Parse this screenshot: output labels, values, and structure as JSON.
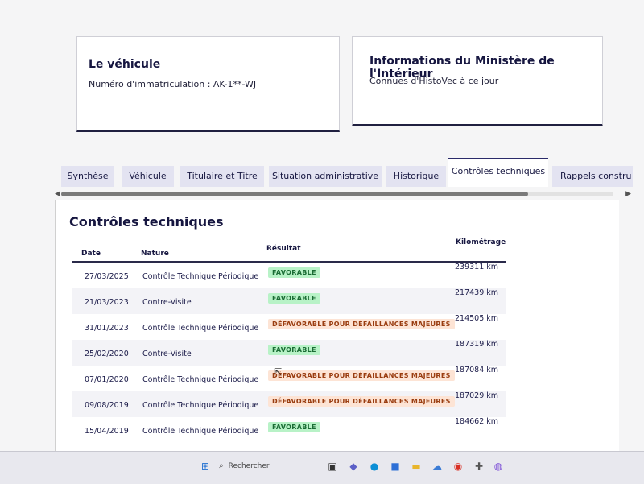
{
  "vehicle_card": {
    "title": "Le véhicule",
    "plate_line": "Numéro d'immatriculation : AK-1**-WJ"
  },
  "ministry_card": {
    "title": "Informations du Ministère de l'Intérieur",
    "subtitle": "Connues d'HistoVec à ce jour"
  },
  "tabs": [
    {
      "label": "Synthèse",
      "active": false
    },
    {
      "label": "Véhicule",
      "active": false
    },
    {
      "label": "Titulaire et Titre",
      "active": false
    },
    {
      "label": "Situation administrative",
      "active": false
    },
    {
      "label": "Historique",
      "active": false
    },
    {
      "label": "Contrôles techniques",
      "active": true
    },
    {
      "label": "Rappels constru",
      "active": false
    }
  ],
  "section": {
    "title": "Contrôles techniques",
    "columns": {
      "date": "Date",
      "nature": "Nature",
      "result": "Résultat",
      "km": "Kilométrage"
    },
    "rows": [
      {
        "date": "27/03/2025",
        "nature": "Contrôle Technique Périodique",
        "result": "FAVORABLE",
        "status": "ok",
        "km": "239311 km"
      },
      {
        "date": "21/03/2023",
        "nature": "Contre-Visite",
        "result": "FAVORABLE",
        "status": "ok",
        "km": "217439 km"
      },
      {
        "date": "31/01/2023",
        "nature": "Contrôle Technique Périodique",
        "result": "DÉFAVORABLE POUR DÉFAILLANCES MAJEURES",
        "status": "ko",
        "km": "214505 km"
      },
      {
        "date": "25/02/2020",
        "nature": "Contre-Visite",
        "result": "FAVORABLE",
        "status": "ok",
        "km": "187319 km"
      },
      {
        "date": "07/01/2020",
        "nature": "Contrôle Technique Périodique",
        "result": "DÉFAVORABLE POUR DÉFAILLANCES MAJEURES",
        "status": "ko",
        "km": "187084 km"
      },
      {
        "date": "09/08/2019",
        "nature": "Contrôle Technique Périodique",
        "result": "DÉFAVORABLE POUR DÉFAILLANCES MAJEURES",
        "status": "ko",
        "km": "187029 km"
      },
      {
        "date": "15/04/2019",
        "nature": "Contrôle Technique Périodique",
        "result": "FAVORABLE",
        "status": "ok",
        "km": "184662 km"
      }
    ]
  },
  "taskbar": {
    "search_label": "Rechercher",
    "icons": [
      {
        "name": "windows-start-icon",
        "glyph": "⊞",
        "color": "#1f6fd1"
      },
      {
        "name": "task-view-icon",
        "glyph": "▣",
        "color": "#333333"
      },
      {
        "name": "teams-icon",
        "glyph": "◆",
        "color": "#5b5fc7"
      },
      {
        "name": "edge-icon",
        "glyph": "●",
        "color": "#0c8fd6"
      },
      {
        "name": "store-icon",
        "glyph": "■",
        "color": "#2d6fd6"
      },
      {
        "name": "file-explorer-icon",
        "glyph": "▬",
        "color": "#e8b52c"
      },
      {
        "name": "weather-icon",
        "glyph": "☁",
        "color": "#3a7bd5"
      },
      {
        "name": "chrome-icon",
        "glyph": "◉",
        "color": "#d93025"
      },
      {
        "name": "app-icon",
        "glyph": "✚",
        "color": "#555555"
      },
      {
        "name": "messenger-icon",
        "glyph": "◍",
        "color": "#7a4bd6"
      }
    ]
  }
}
